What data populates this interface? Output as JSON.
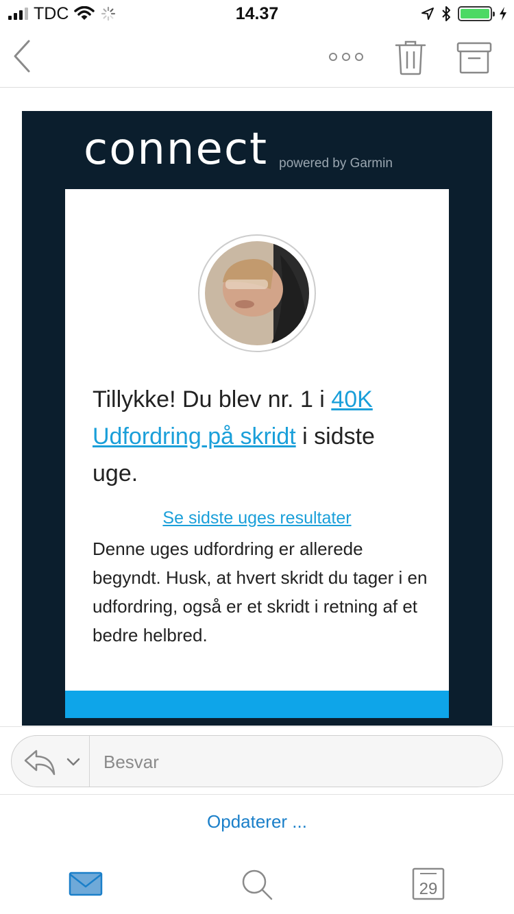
{
  "status_bar": {
    "carrier": "TDC",
    "time": "14.37",
    "battery_level": 1.0
  },
  "nav_bar": {
    "icons": [
      "back-chevron-icon",
      "more-icon",
      "trash-icon",
      "archive-icon"
    ]
  },
  "email": {
    "brand_logo": "connect",
    "brand_tagline": "powered by Garmin",
    "headline_before": "Tillykke! Du blev nr. 1 i ",
    "headline_link": "40K Udfordring på skridt",
    "headline_after": " i sidste uge.",
    "results_link": "Se sidste uges resultater",
    "body_text": "Denne uges udfordring er allerede begyndt. Husk, at hvert skridt du tager i en udfordring, også er et skridt i retning af et bedre helbred.",
    "accent_color": "#0ea5e9",
    "header_color": "#0b1e2d",
    "link_color": "#1a9fd9"
  },
  "reply_bar": {
    "placeholder": "Besvar"
  },
  "sync_status": "Opdaterer ...",
  "tab_bar": {
    "calendar_day": "29",
    "icons": [
      "mail-icon",
      "search-icon",
      "calendar-icon"
    ]
  }
}
